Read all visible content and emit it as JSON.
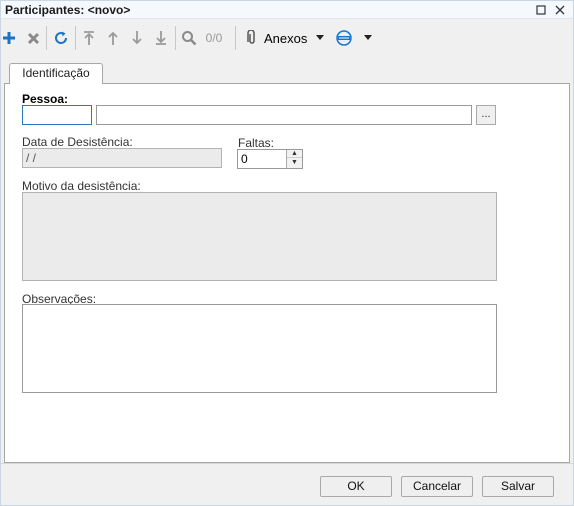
{
  "window": {
    "title": "Participantes: <novo>",
    "maximize_icon": "maximize-icon",
    "close_icon": "close-icon"
  },
  "toolbar": {
    "record_counter": "0/0",
    "attachments_label": "Anexos",
    "icons": [
      "plus-icon",
      "delete-icon",
      "refresh-icon",
      "first-record-icon",
      "previous-record-icon",
      "next-record-icon",
      "last-record-icon",
      "search-icon",
      "paperclip-icon",
      "chevron-down-icon",
      "globe-icon",
      "chevron-down-icon"
    ]
  },
  "tabs": [
    {
      "label": "Identificação"
    }
  ],
  "form": {
    "pessoa": {
      "label": "Pessoa:",
      "code_value": "",
      "name_value": "",
      "lookup_label": "..."
    },
    "data_desistencia": {
      "label": "Data de Desistência:",
      "value": " / /"
    },
    "faltas": {
      "label": "Faltas:",
      "value": "0"
    },
    "motivo": {
      "label": "Motivo da desistência:",
      "value": ""
    },
    "observacoes": {
      "label": "Observações:",
      "value": ""
    }
  },
  "footer": {
    "ok_label": "OK",
    "cancel_label": "Cancelar",
    "save_label": "Salvar"
  },
  "colors": {
    "accent": "#1a73c7",
    "disabled_field": "#ebebeb",
    "focus_border": "#2f74c0"
  }
}
